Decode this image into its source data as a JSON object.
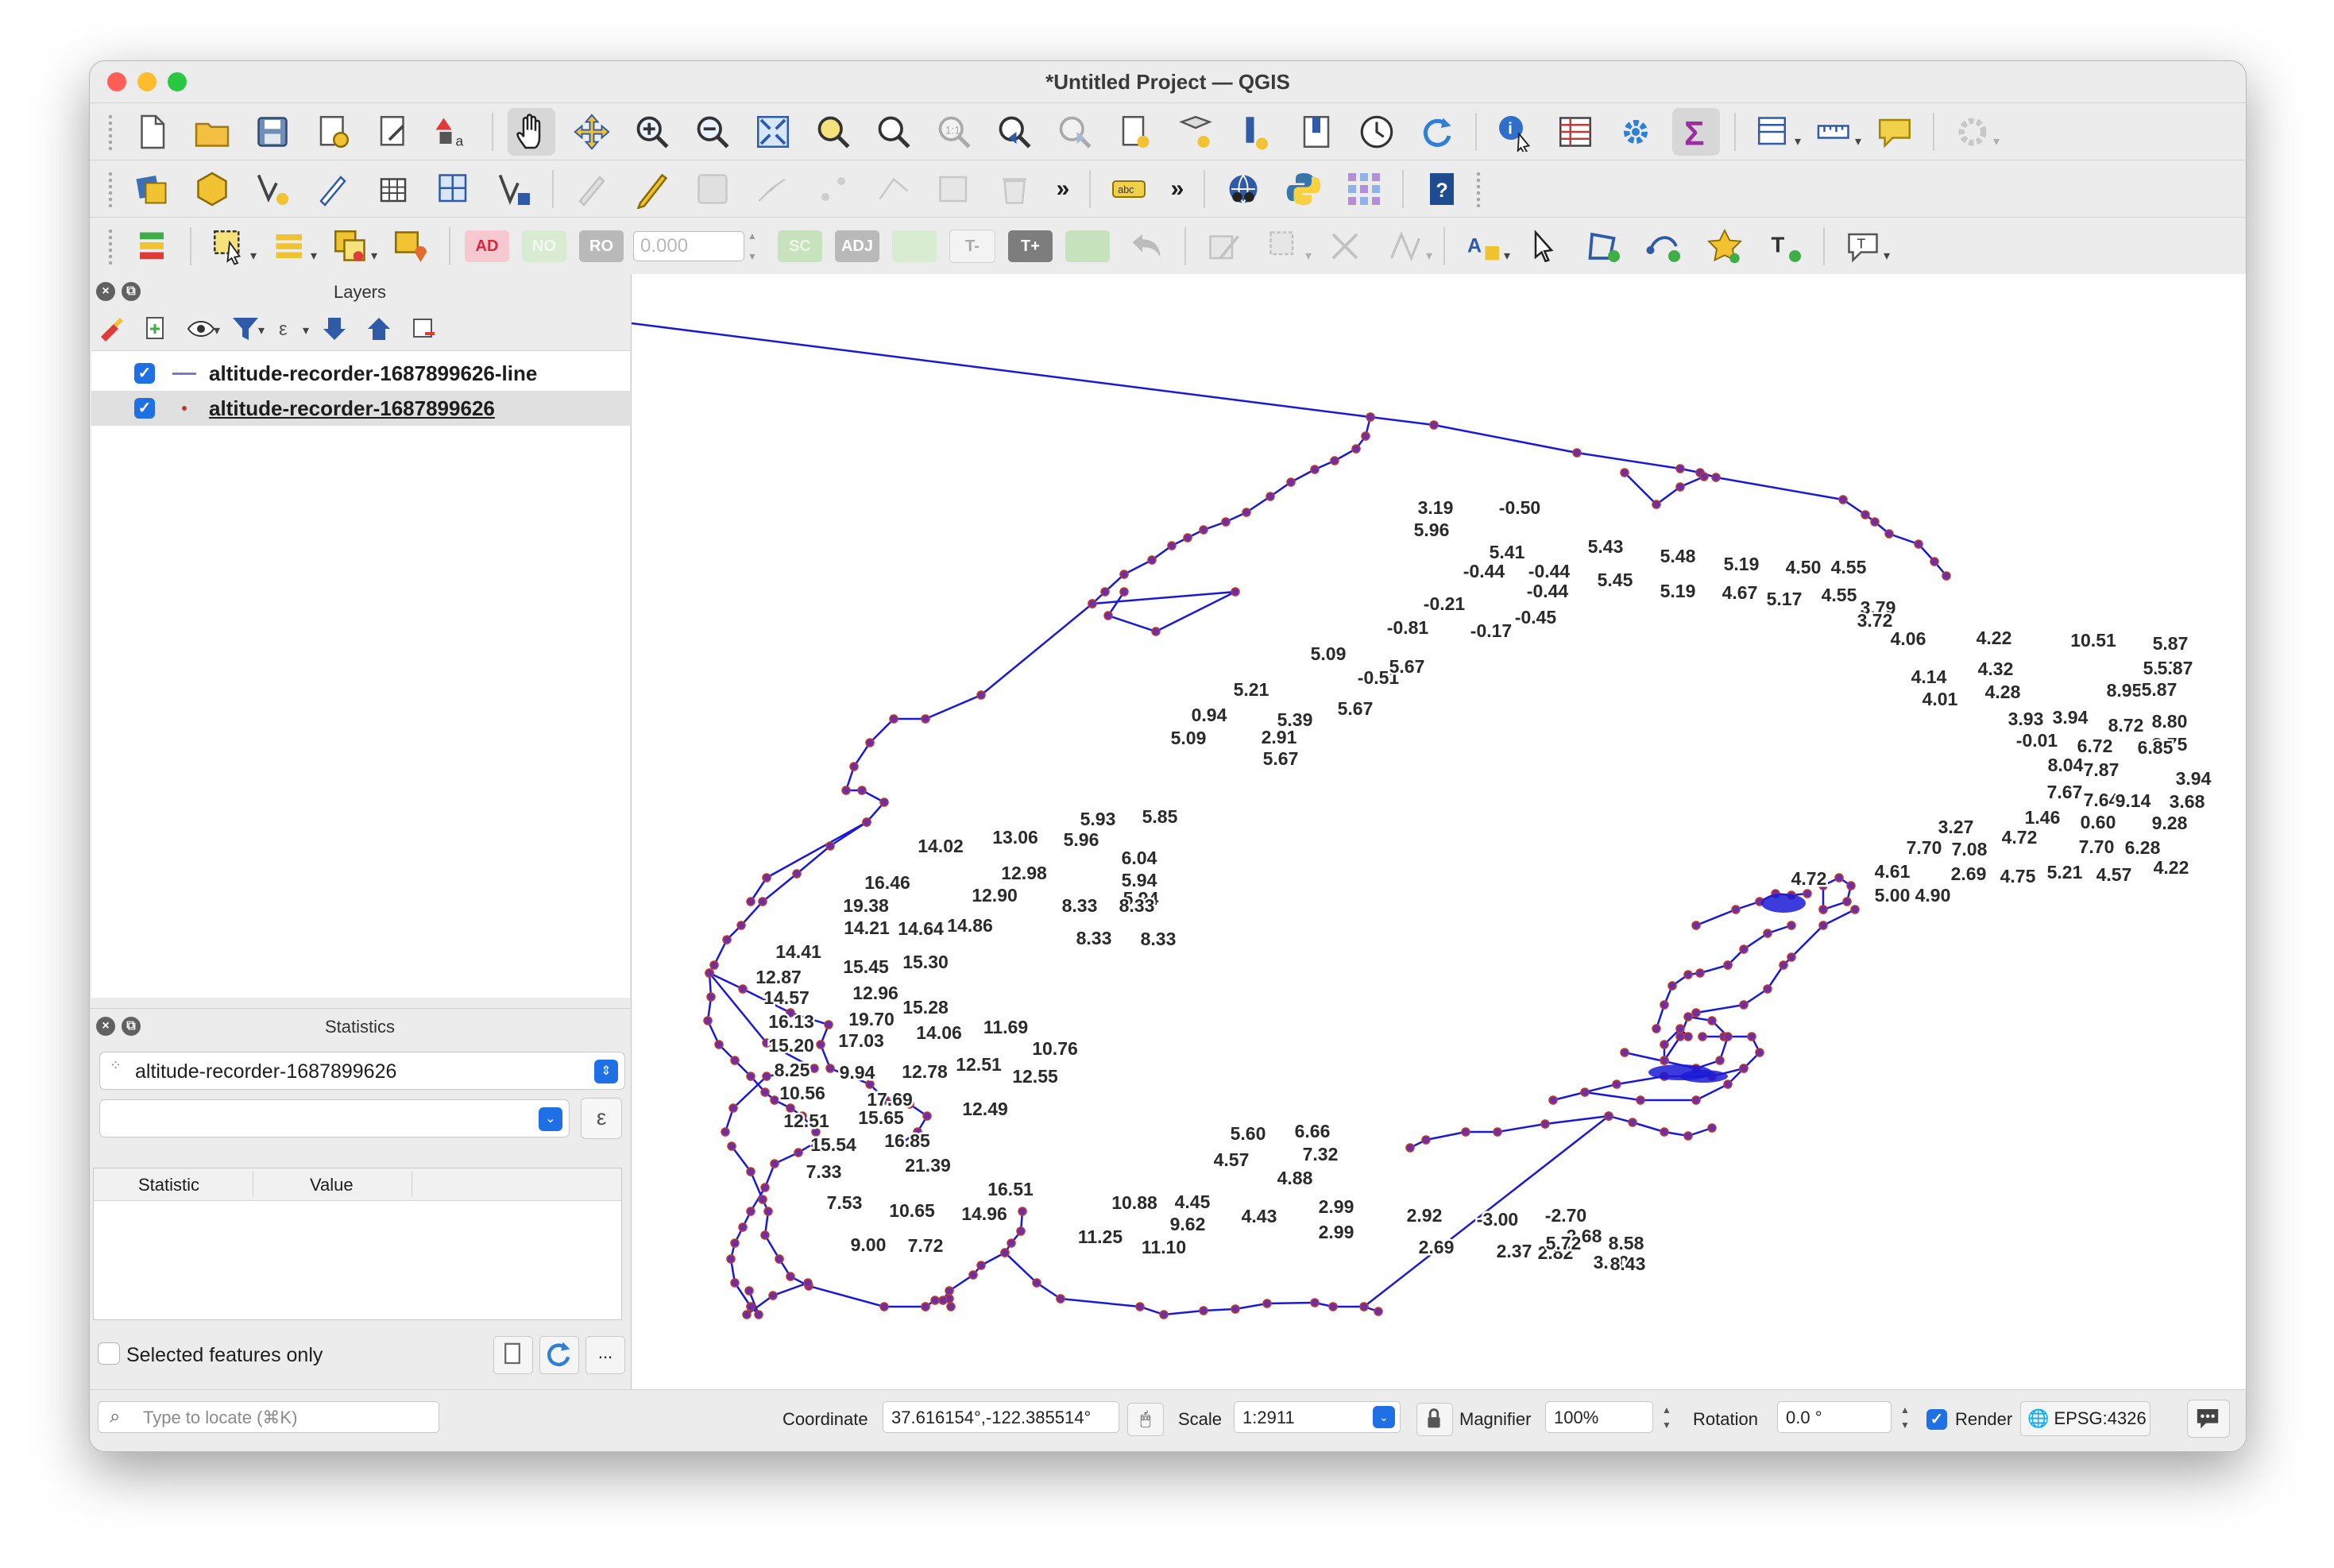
{
  "window": {
    "title": "*Untitled Project — QGIS"
  },
  "toolbars": {
    "row1": [
      "new-project",
      "open-project",
      "save-project",
      "new-print-layout",
      "layout-manager",
      "style-manager",
      "pan-map",
      "pan-to-selection",
      "zoom-in",
      "zoom-out",
      "zoom-full",
      "zoom-to-selection",
      "zoom-to-layer",
      "zoom-native",
      "zoom-last",
      "zoom-next",
      "new-bookmark",
      "show-bookmarks",
      "new-3d-map",
      "new-map-view",
      "temporal-controller",
      "refresh",
      "identify-features",
      "open-attribute-table",
      "toolbox",
      "statistical-summary",
      "open-field-calculator",
      "measure",
      "annotation",
      "plugins"
    ],
    "row2": [
      "data-source-manager",
      "new-geopackage-layer",
      "new-shapefile-layer",
      "digitize",
      "new-spatialite",
      "new-virtual-layer",
      "vertex-tool",
      "toggle-editing",
      "current-edits",
      "save-edits",
      "add-feature",
      "move-feature",
      "node-tool",
      "delete-selected",
      "more",
      "label-tool",
      "more",
      "georeferencer",
      "python-console",
      "grid-plugin",
      "help"
    ],
    "row3_text_buttons": {
      "ad": "AD",
      "no": "NO",
      "ro": "RO",
      "sc": "SC",
      "adj": "ADJ",
      "t_minus": "T-",
      "t_plus": "T+"
    },
    "tolerance_value": "0.000"
  },
  "layers_panel": {
    "title": "Layers",
    "layers": [
      {
        "name": "altitude-recorder-1687899626-line",
        "checked": true,
        "symbol": "line",
        "color": "#7b7bc2"
      },
      {
        "name": "altitude-recorder-1687899626",
        "checked": true,
        "symbol": "point",
        "color": "#c0392b"
      }
    ]
  },
  "statistics_panel": {
    "title": "Statistics",
    "layer": "altitude-recorder-1687899626",
    "expression_button": "ε",
    "columns": [
      "Statistic",
      "Value"
    ],
    "selected_only_label": "Selected features only",
    "more_button": "..."
  },
  "status_bar": {
    "locate_placeholder": "Type to locate (⌘K)",
    "coordinate_label": "Coordinate",
    "coordinate_value": "37.616154°,-122.385514°",
    "scale_label": "Scale",
    "scale_value": "1:2911",
    "magnifier_label": "Magnifier",
    "magnifier_value": "100%",
    "rotation_label": "Rotation",
    "rotation_value": "0.0 °",
    "render_label": "Render",
    "crs": "EPSG:4326"
  },
  "colors": {
    "track_line": "#1a1ad6",
    "point_fill": "#6b2fa8",
    "point_outline": "#c0392b",
    "accent": "#1f6fe5"
  },
  "map_labels": [
    "3.19",
    "-0.50",
    "5.96",
    "5.41",
    "5.43",
    "5.48",
    "-0.44",
    "-0.44",
    "-0.44",
    "5.45",
    "5.19",
    "5.19",
    "4.67",
    "5.17",
    "4.50",
    "4.55",
    "4.55",
    "-0.21",
    "-0.45",
    "-0.81",
    "-0.17",
    "3.79",
    "3.72",
    "4.06",
    "4.22",
    "10.51",
    "5.87",
    "5.87",
    "5.87",
    "8.95",
    "5.87",
    "5.09",
    "-0.51",
    "5.67",
    "4.14",
    "4.32",
    "4.01",
    "4.28",
    "5.21",
    "0.94",
    "5.67",
    "5.39",
    "5.09",
    "2.91",
    "5.67",
    "3.93",
    "3.94",
    "8.72",
    "8.80",
    "8.75",
    "-0.01",
    "6.72",
    "6.85",
    "8.04",
    "7.87",
    "3.94",
    "7.67",
    "7.64",
    "9.14",
    "3.68",
    "9.28",
    "1.46",
    "0.60",
    "3.27",
    "4.72",
    "7.70",
    "7.08",
    "7.70",
    "6.28",
    "4.22",
    "4.57",
    "5.21",
    "4.75",
    "2.69",
    "4.90",
    "4.61",
    "5.00",
    "4.72",
    "5.93",
    "5.85",
    "14.02",
    "13.06",
    "5.96",
    "6.04",
    "12.98",
    "5.94",
    "5.94",
    "16.46",
    "12.90",
    "8.33",
    "8.33",
    "19.38",
    "14.21",
    "14.64",
    "14.86",
    "8.33",
    "8.33",
    "14.41",
    "15.45",
    "15.30",
    "12.87",
    "14.57",
    "12.96",
    "15.28",
    "16.13",
    "19.70",
    "17.03",
    "14.06",
    "11.69",
    "15.20",
    "10.76",
    "8.25",
    "9.94",
    "12.78",
    "12.51",
    "12.55",
    "10.56",
    "17.69",
    "12.49",
    "12.51",
    "15.65",
    "15.54",
    "16.85",
    "7.33",
    "21.39",
    "16.51",
    "7.53",
    "10.65",
    "14.96",
    "9.00",
    "7.72",
    "10.88",
    "4.45",
    "9.62",
    "11.25",
    "11.10",
    "5.60",
    "6.66",
    "4.57",
    "7.32",
    "4.88",
    "4.43",
    "2.99",
    "2.92",
    "2.99",
    "2.69",
    "-3.00",
    "-2.70",
    "2.68",
    "2.37",
    "2.82",
    "3.00",
    "5.72",
    "8.58",
    "8.43"
  ]
}
